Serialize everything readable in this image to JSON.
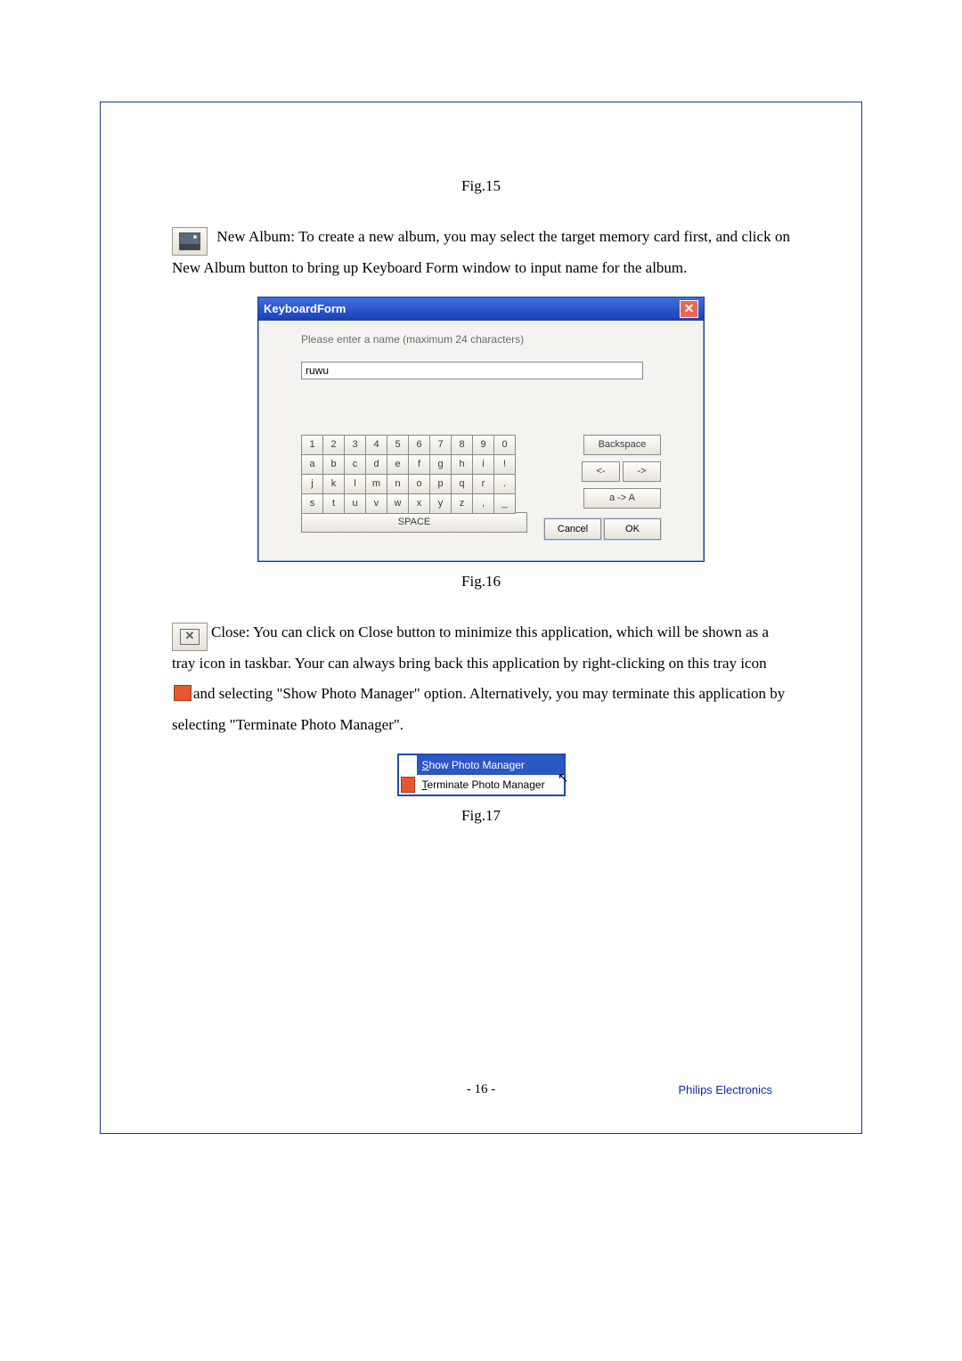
{
  "fig15_label": "Fig.15",
  "new_album_icon_name": "new-album-icon",
  "paragraph_new_album_lead": " New Album: To create a new album, you may select the target memory card first, and click on New Album button to bring up Keyboard Form window to input name for the album.",
  "keyboard_form": {
    "title": "KeyboardForm",
    "prompt": "Please enter a name (maximum 24 characters)",
    "input_value": "ruwu",
    "keys_row1": [
      "1",
      "2",
      "3",
      "4",
      "5",
      "6",
      "7",
      "8",
      "9",
      "0"
    ],
    "keys_row2": [
      "a",
      "b",
      "c",
      "d",
      "e",
      "f",
      "g",
      "h",
      "i",
      "!"
    ],
    "keys_row3": [
      "j",
      "k",
      "l",
      "m",
      "n",
      "o",
      "p",
      "q",
      "r",
      "."
    ],
    "keys_row4": [
      "s",
      "t",
      "u",
      "v",
      "w",
      "x",
      "y",
      "z",
      ",",
      "_"
    ],
    "space_label": "SPACE",
    "backspace_label": "Backspace",
    "left_arrow_label": "<-",
    "right_arrow_label": "->",
    "shift_label": "a -> A",
    "cancel_label": "Cancel",
    "ok_label": "OK"
  },
  "fig16_label": "Fig.16",
  "close_icon_name": "close-icon",
  "paragraph_close_part1": "Close: You can click on Close button to minimize this application, which will be shown as a tray icon in taskbar. Your can always bring back this application by right-clicking on this tray icon ",
  "paragraph_close_part2": "and selecting \"Show Photo Manager\" option. Alternatively, you may terminate this application by selecting \"Terminate Photo Manager\".",
  "tray_menu": {
    "item1_mnemonic": "S",
    "item1_rest": "how Photo Manager",
    "item2_mnemonic": "T",
    "item2_rest": "erminate Photo Manager"
  },
  "fig17_label": "Fig.17",
  "footer": {
    "page_number": "- 16 -",
    "company": "Philips Electronics"
  }
}
